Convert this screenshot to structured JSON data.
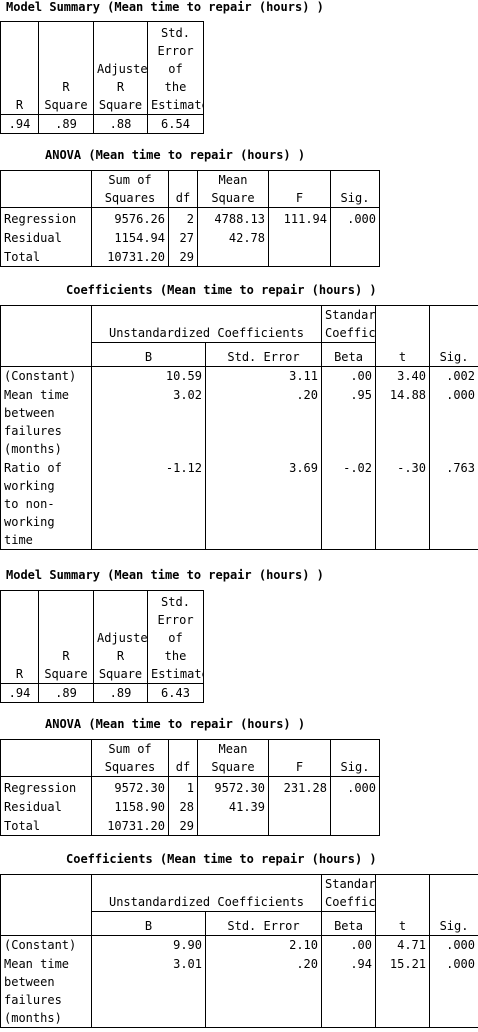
{
  "section1": {
    "title": "Model Summary (Mean time to repair (hours) )",
    "headers": {
      "r": "R",
      "r_square": [
        "R",
        "Square"
      ],
      "adj": [
        "Adjusted",
        "R",
        "Square"
      ],
      "se": [
        "Std.",
        "Error",
        "of",
        "the",
        "Estimate"
      ]
    },
    "row": {
      "r": ".94",
      "r_square": ".89",
      "adj": ".88",
      "se": "6.54"
    }
  },
  "section2": {
    "title": "ANOVA (Mean time to repair (hours) )",
    "headers": {
      "ss": [
        "Sum of",
        "Squares"
      ],
      "df": "df",
      "ms": [
        "Mean",
        "Square"
      ],
      "f": "F",
      "sig": "Sig."
    },
    "rows": [
      {
        "label": "Regression",
        "ss": "9576.26",
        "df": "2",
        "ms": "4788.13",
        "f": "111.94",
        "sig": ".000"
      },
      {
        "label": "Residual",
        "ss": "1154.94",
        "df": "27",
        "ms": "42.78",
        "f": "",
        "sig": ""
      },
      {
        "label": "Total",
        "ss": "10731.20",
        "df": "29",
        "ms": "",
        "f": "",
        "sig": ""
      }
    ]
  },
  "section3": {
    "title": "Coefficients (Mean time to repair (hours) )",
    "headers": {
      "unstd": "Unstandardized Coefficients",
      "std": [
        "Standardized",
        "Coefficients"
      ],
      "b": "B",
      "se": "Std. Error",
      "beta": "Beta",
      "t": "t",
      "sig": "Sig."
    },
    "rows": [
      {
        "label": [
          "(Constant)"
        ],
        "b": "10.59",
        "se": "3.11",
        "beta": ".00",
        "t": "3.40",
        "sig": ".002"
      },
      {
        "label": [
          "Mean time",
          "between",
          "failures",
          "(months)"
        ],
        "b": "3.02",
        "se": ".20",
        "beta": ".95",
        "t": "14.88",
        "sig": ".000"
      },
      {
        "label": [
          "Ratio of",
          "working",
          "to non-",
          "working",
          "time"
        ],
        "b": "-1.12",
        "se": "3.69",
        "beta": "-.02",
        "t": "-.30",
        "sig": ".763"
      }
    ]
  },
  "section4": {
    "title": "Model Summary (Mean time to repair (hours) )",
    "headers": {
      "r": "R",
      "r_square": [
        "R",
        "Square"
      ],
      "adj": [
        "Adjusted",
        "R",
        "Square"
      ],
      "se": [
        "Std.",
        "Error",
        "of",
        "the",
        "Estimate"
      ]
    },
    "row": {
      "r": ".94",
      "r_square": ".89",
      "adj": ".89",
      "se": "6.43"
    }
  },
  "section5": {
    "title": "ANOVA (Mean time to repair (hours) )",
    "headers": {
      "ss": [
        "Sum of",
        "Squares"
      ],
      "df": "df",
      "ms": [
        "Mean",
        "Square"
      ],
      "f": "F",
      "sig": "Sig."
    },
    "rows": [
      {
        "label": "Regression",
        "ss": "9572.30",
        "df": "1",
        "ms": "9572.30",
        "f": "231.28",
        "sig": ".000"
      },
      {
        "label": "Residual",
        "ss": "1158.90",
        "df": "28",
        "ms": "41.39",
        "f": "",
        "sig": ""
      },
      {
        "label": "Total",
        "ss": "10731.20",
        "df": "29",
        "ms": "",
        "f": "",
        "sig": ""
      }
    ]
  },
  "section6": {
    "title": "Coefficients (Mean time to repair (hours) )",
    "headers": {
      "unstd": "Unstandardized Coefficients",
      "std": [
        "Standardized",
        "Coefficients"
      ],
      "b": "B",
      "se": "Std. Error",
      "beta": "Beta",
      "t": "t",
      "sig": "Sig."
    },
    "rows": [
      {
        "label": [
          "(Constant)"
        ],
        "b": "9.90",
        "se": "2.10",
        "beta": ".00",
        "t": "4.71",
        "sig": ".000"
      },
      {
        "label": [
          "Mean time",
          "between",
          "failures",
          "(months)"
        ],
        "b": "3.01",
        "se": ".20",
        "beta": ".94",
        "t": "15.21",
        "sig": ".000"
      }
    ]
  }
}
